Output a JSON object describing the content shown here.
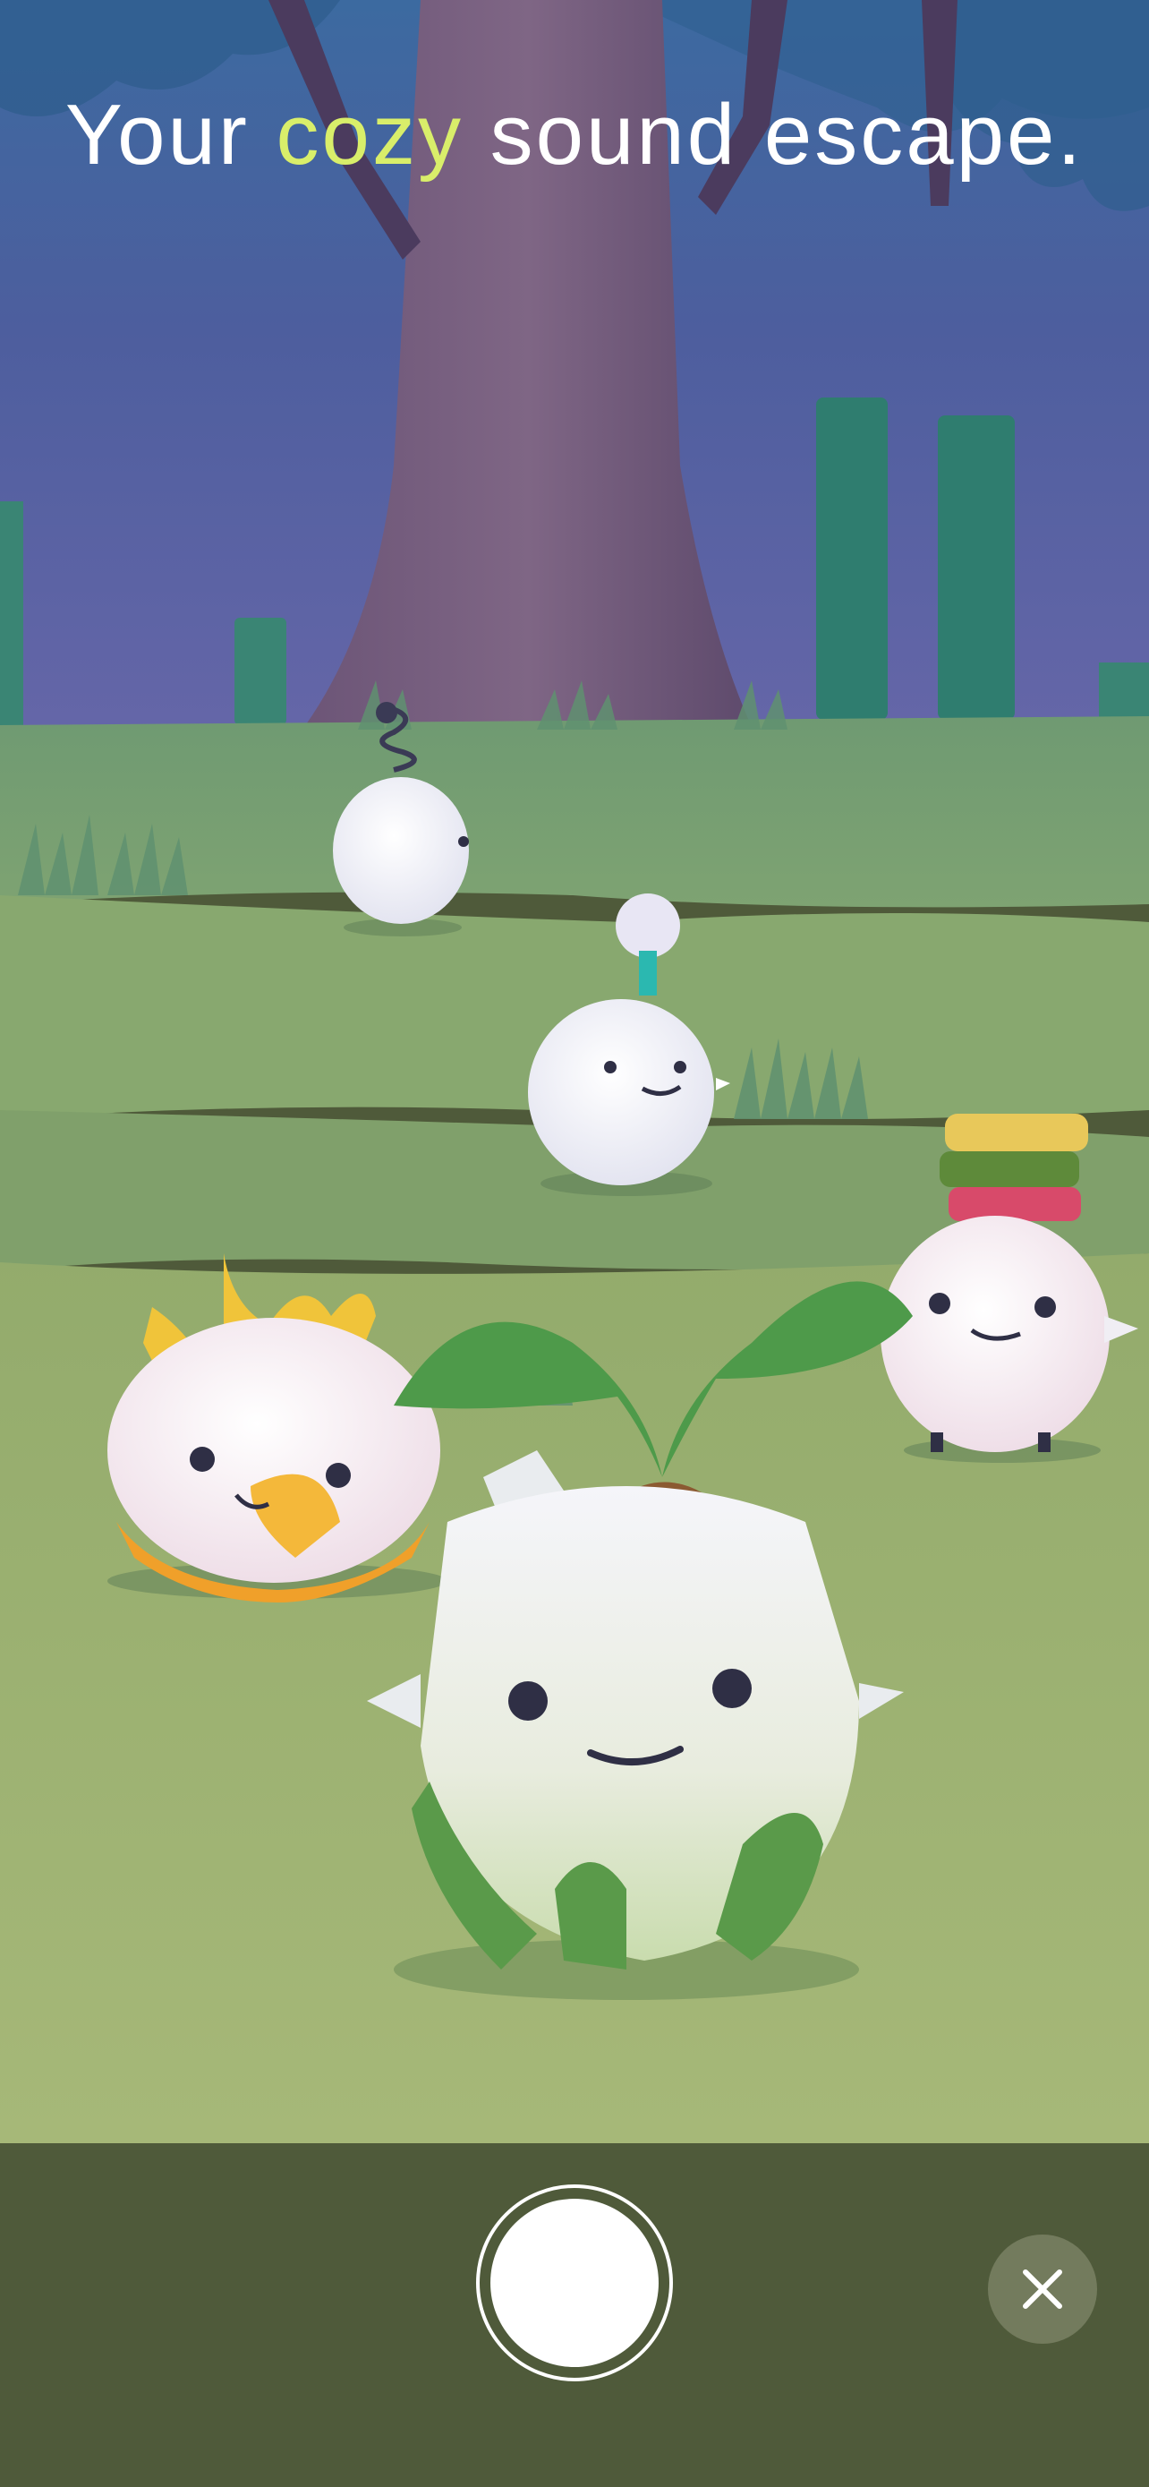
{
  "headline": {
    "before": "Your",
    "accent": "cozy",
    "after": "sound escape."
  },
  "colors": {
    "accent": "#d9ee6a",
    "sky_top": "#3c6aa0",
    "sky_bottom": "#5a5ca0",
    "grass": "#9fb36c",
    "bottom_bar": "#4f5a3a"
  },
  "controls": {
    "capture": "capture-button",
    "close": "close-icon"
  }
}
